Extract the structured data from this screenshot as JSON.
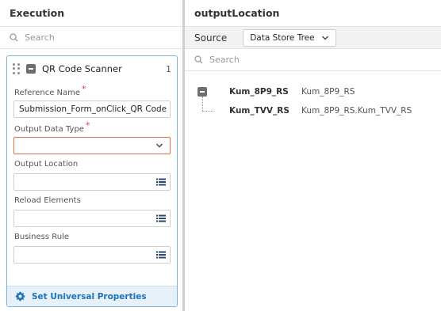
{
  "left_panel": {
    "title": "Execution",
    "search_placeholder": "Search",
    "card": {
      "title": "QR Code Scanner",
      "count": "1",
      "fields": {
        "reference_name": {
          "label": "Reference Name",
          "required": "*",
          "value": "Submission_Form_onClick_QR Code"
        },
        "output_data_type": {
          "label": "Output Data Type",
          "required": "*",
          "value": ""
        },
        "output_location": {
          "label": "Output Location",
          "value": ""
        },
        "reload_elements": {
          "label": "Reload Elements",
          "value": ""
        },
        "business_rule": {
          "label": "Business Rule",
          "value": ""
        }
      },
      "footer_label": "Set Universal Properties"
    }
  },
  "right_panel": {
    "title": "outputLocation",
    "source_label": "Source",
    "source_value": "Data Store Tree",
    "search_placeholder": "Search",
    "tree": [
      {
        "name": "Kum_8P9_RS",
        "path": "Kum_8P9_RS"
      },
      {
        "name": "Kum_TVV_RS",
        "path": "Kum_8P9_RS.Kum_TVV_RS"
      }
    ]
  },
  "colors": {
    "accent": "#1f72b8",
    "card_border": "#7fb3db",
    "error_border": "#e0704a",
    "required_mark": "#e03a3a",
    "footer_bg": "#e6f1fa"
  },
  "icons": [
    "search-icon",
    "drag-handle-icon",
    "collapse-icon",
    "chevron-down-icon",
    "list-icon",
    "gear-icon"
  ]
}
